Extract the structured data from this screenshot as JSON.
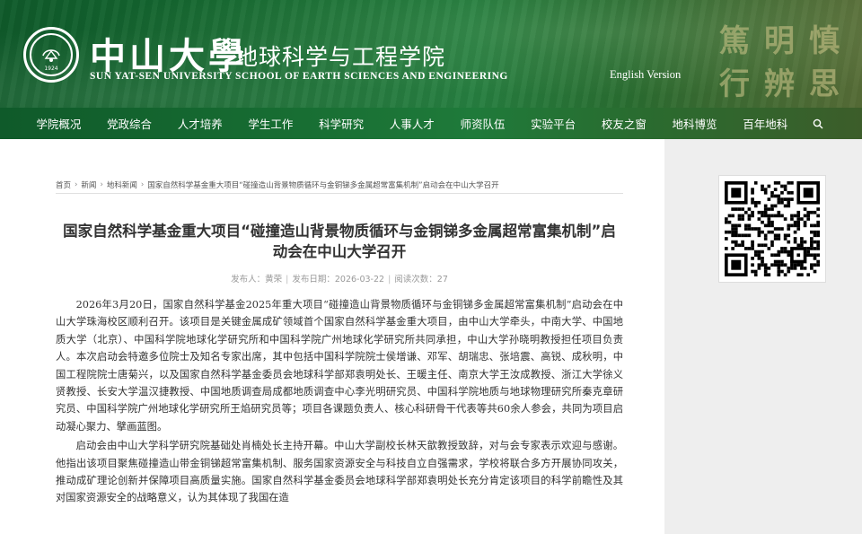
{
  "header": {
    "university_cn": "中山大學",
    "school_cn": "地球科学与工程学院",
    "university_en": "SUN YAT-SEN UNIVERSITY",
    "school_en": "SCHOOL OF EARTH SCIENCES AND ENGINEERING",
    "seal_year": "1924",
    "english_link": "English Version",
    "motto": [
      "篤",
      "明",
      "慎",
      "行",
      "辨",
      "思"
    ]
  },
  "nav": {
    "items": [
      "学院概况",
      "党政综合",
      "人才培养",
      "学生工作",
      "科学研究",
      "人事人才",
      "师资队伍",
      "实验平台",
      "校友之窗",
      "地科博览",
      "百年地科"
    ],
    "search_icon": "search-icon"
  },
  "breadcrumb": [
    "首页",
    "新闻",
    "地科新闻",
    "国家自然科学基金重大项目“碰撞造山背景物质循环与金铜锑多金属超常富集机制”启动会在中山大学召开"
  ],
  "article": {
    "title": "国家自然科学基金重大项目“碰撞造山背景物质循环与金铜锑多金属超常富集机制”启动会在中山大学召开",
    "author_label": "发布人：",
    "author": "黄荣",
    "date_label": "发布日期：",
    "date": "2026-03-22",
    "views_label": "阅读次数：",
    "views": "27",
    "paragraphs": [
      "2026年3月20日，国家自然科学基金2025年重大项目“碰撞造山背景物质循环与金铜锑多金属超常富集机制”启动会在中山大学珠海校区顺利召开。该项目是关键金属成矿领域首个国家自然科学基金重大项目，由中山大学牵头，中南大学、中国地质大学（北京）、中国科学院地球化学研究所和中国科学院广州地球化学研究所共同承担，中山大学孙晓明教授担任项目负责人。本次启动会特邀多位院士及知名专家出席，其中包括中国科学院院士侯增谦、邓军、胡瑞忠、张培震、高锐、成秋明，中国工程院院士唐菊兴，以及国家自然科学基金委员会地球科学部郑袁明处长、王暖主任、南京大学王汝成教授、浙江大学徐义贤教授、长安大学温汉捷教授、中国地质调查局成都地质调查中心李光明研究员、中国科学院地质与地球物理研究所秦克章研究员、中国科学院广州地球化学研究所王焰研究员等；项目各课题负责人、核心科研骨干代表等共60余人参会，共同为项目启动凝心聚力、擘画蓝图。",
      "启动会由中山大学科学研究院基础处肖楠处长主持开幕。中山大学副校长林天歆教授致辞，对与会专家表示欢迎与感谢。他指出该项目聚焦碰撞造山带金铜锑超常富集机制、服务国家资源安全与科技自立自强需求，学校将联合多方开展协同攻关，推动成矿理论创新并保障项目高质量实施。国家自然科学基金委员会地球科学部郑袁明处长充分肯定该项目的科学前瞻性及其对国家资源安全的战略意义，认为其体现了我国在造"
    ]
  },
  "sidebar": {
    "qr_icon": "qr-code-icon"
  },
  "colors": {
    "banner_green": "#1f7a3a",
    "title_text": "#333333",
    "meta_text": "#999999",
    "sidebar_bg": "#eeeeee"
  }
}
